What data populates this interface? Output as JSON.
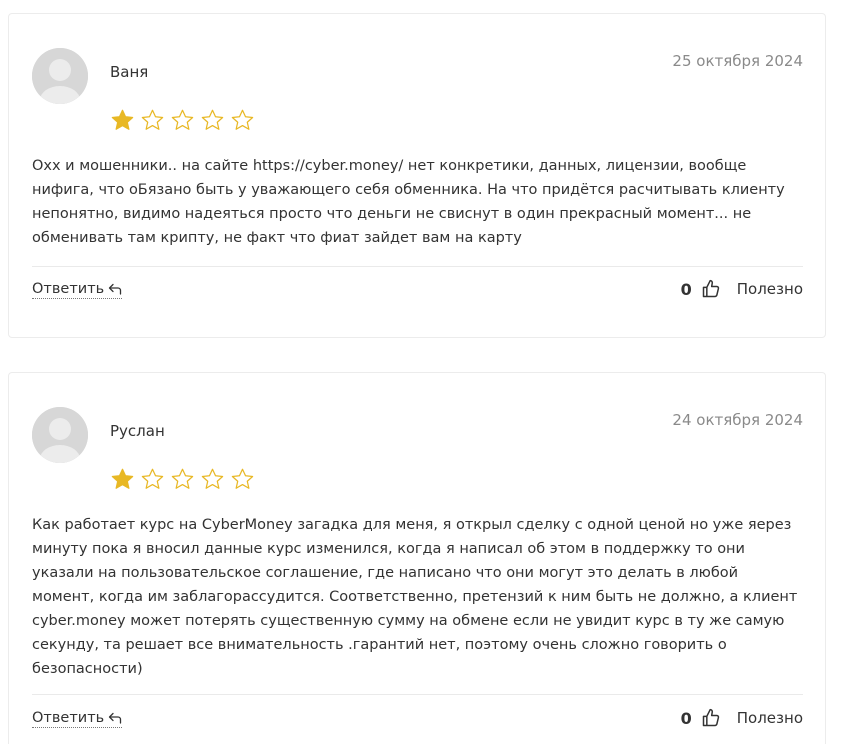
{
  "reviews": [
    {
      "author": "Ваня",
      "date": "25 октября 2024",
      "rating": 1,
      "max_rating": 5,
      "text": "Охх и мошенники.. на сайте https://cyber.money/ нет конкретики, данных, лицензии, вообще нифига, что оБязано быть у уважающего себя обменника. На что придётся расчитывать клиенту непонятно, видимо надеяться просто что деньги не свиснут в один прекрасный момент... не обменивать там крипту, не факт что фиат зайдет вам на карту",
      "reply_label": "Ответить",
      "votes": "0",
      "useful_label": "Полезно"
    },
    {
      "author": "Руслан",
      "date": "24 октября 2024",
      "rating": 1,
      "max_rating": 5,
      "text": "Как работает курс на CyberMoney загадка для меня, я открыл сделку с одной ценой но уже яерез минуту пока я вносил данные курс изменился, когда я написал об этом в поддержку то они указали на пользовательское соглашение, где написано что они могут это делать в любой момент, когда им заблагорассудится. Соответственно, претензий к ним быть не должно, а клиент cyber.money может потерять существенную сумму на обмене если не увидит курс в ту же самую секунду, та решает все внимательность .гарантий нет, поэтому очень сложно говорить о безопасности)",
      "reply_label": "Ответить",
      "votes": "0",
      "useful_label": "Полезно"
    }
  ],
  "colors": {
    "star_filled": "#e8b825",
    "star_empty_stroke": "#e8b825",
    "avatar_bg": "#d7d7d7",
    "date_text": "#8a8a8a"
  },
  "icons": {
    "avatar": "user-silhouette-icon",
    "star": "star-icon",
    "reply": "reply-arrow-icon",
    "like": "thumbs-up-icon"
  }
}
